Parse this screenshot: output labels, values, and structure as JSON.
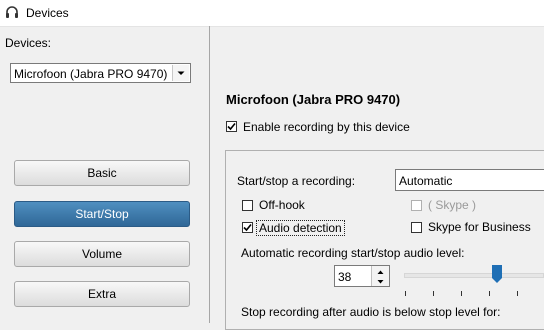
{
  "window": {
    "title": "Devices",
    "icon": "headset-icon"
  },
  "sidebar": {
    "devices_label": "Devices:",
    "device_select": {
      "value": "Microfoon (Jabra PRO 9470)"
    },
    "nav": [
      {
        "label": "Basic",
        "active": false
      },
      {
        "label": "Start/Stop",
        "active": true
      },
      {
        "label": "Volume",
        "active": false
      },
      {
        "label": "Extra",
        "active": false
      }
    ]
  },
  "main": {
    "device_title": "Microfoon (Jabra PRO 9470)",
    "enable_recording": {
      "label": "Enable recording by this device",
      "checked": true
    },
    "start_stop": {
      "label": "Start/stop a recording:",
      "mode_value": "Automatic",
      "options": [
        {
          "label": "Off-hook",
          "checked": false,
          "enabled": true
        },
        {
          "label": "( Skype )",
          "checked": false,
          "enabled": false
        },
        {
          "label": "Audio detection",
          "checked": true,
          "enabled": true
        },
        {
          "label": "Skype for Business",
          "checked": false,
          "enabled": true
        }
      ],
      "level_label": "Automatic recording start/stop audio level:",
      "level_value": "38",
      "stop_label": "Stop recording after audio is below stop level for:"
    }
  },
  "colors": {
    "active_button": "#3a78ab",
    "slider_thumb": "#1f6fb5"
  }
}
